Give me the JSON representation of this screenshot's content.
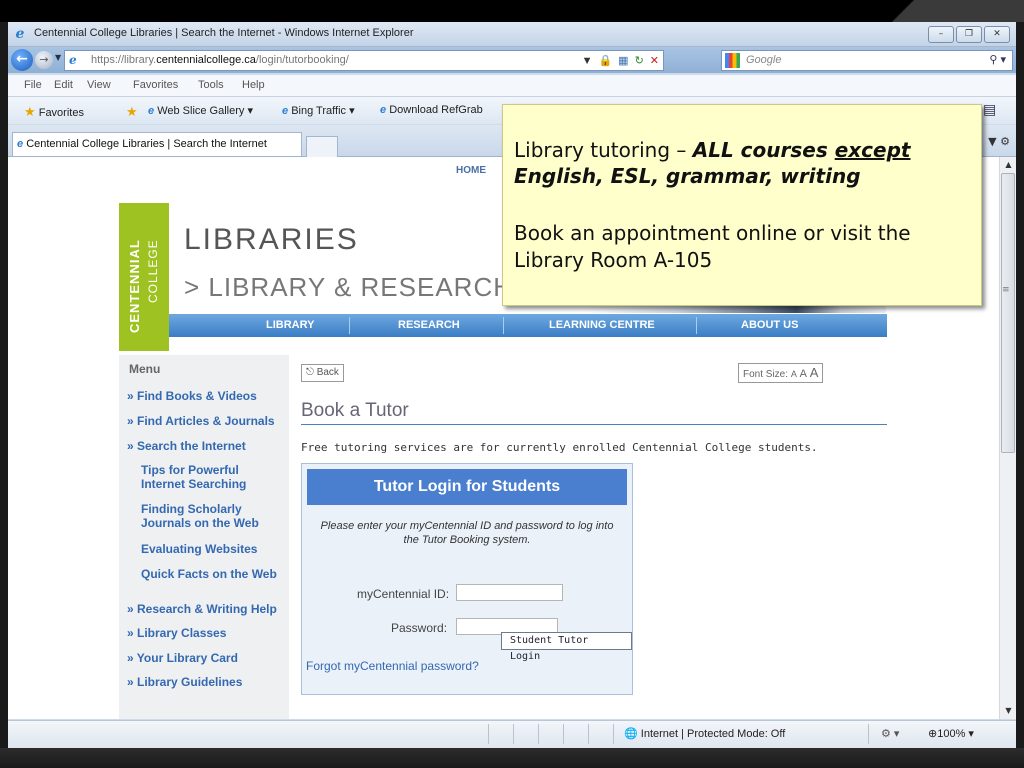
{
  "window": {
    "title": "Centennial College Libraries | Search the Internet - Windows Internet Explorer",
    "minimize": "–",
    "maximize": "❐",
    "close": "✕"
  },
  "address": {
    "url_prefix": "https://library.",
    "url_domain": "centennialcollege.ca",
    "url_path": "/login/tutorbooking/",
    "search_placeholder": "Google"
  },
  "menubar": [
    "File",
    "Edit",
    "View",
    "Favorites",
    "Tools",
    "Help"
  ],
  "favorites_bar": {
    "favorites": "Favorites",
    "web_slice": "Web Slice Gallery ▾",
    "bing": "Bing Traffic ▾",
    "download": "Download RefGrab"
  },
  "tab": {
    "label": "Centennial College Libraries | Search the Internet"
  },
  "site": {
    "home": "HOME",
    "logo_centennial": "CENTENNIAL",
    "logo_college": "COLLEGE",
    "title": "LIBRARIES",
    "subtitle": "> LIBRARY & RESEARCH",
    "nav": [
      "LIBRARY",
      "RESEARCH",
      "LEARNING CENTRE",
      "ABOUT US"
    ]
  },
  "sidebar": {
    "title": "Menu",
    "items": [
      "» Find Books & Videos",
      "» Find Articles & Journals",
      "» Search the Internet"
    ],
    "subitems": [
      "Tips for Powerful Internet Searching",
      "Finding Scholarly Journals on the Web",
      "Evaluating Websites",
      "Quick Facts on the Web"
    ],
    "items_after": [
      "» Research & Writing Help",
      "» Library Classes",
      "» Your Library Card",
      "» Library Guidelines"
    ]
  },
  "main": {
    "back": "Back",
    "font_size_label": "Font Size:",
    "font_sizes": [
      "A",
      "A",
      "A"
    ],
    "heading": "Book a Tutor",
    "intro": "Free tutoring services are for currently enrolled Centennial College students."
  },
  "login": {
    "title": "Tutor Login for Students",
    "instructions": "Please enter your myCentennial ID and password to log into the Tutor Booking system.",
    "id_label": "myCentennial ID:",
    "password_label": "Password:",
    "submit": "Student Tutor Login",
    "forgot": "Forgot myCentennial password?"
  },
  "status": {
    "zone": "Internet | Protected Mode: Off",
    "zoom": "100%"
  },
  "callout": {
    "line1_plain": "Library tutoring – ",
    "line1_bold": "ALL courses ",
    "line1_underline": "except",
    "line2": "English, ESL, grammar, writing",
    "line3": "Book an appointment online or visit the",
    "line4": "Library Room A-105"
  }
}
